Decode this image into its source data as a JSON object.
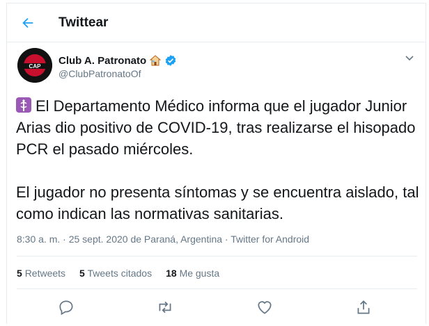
{
  "header": {
    "title": "Twittear"
  },
  "author": {
    "name": "Club A. Patronato",
    "handle": "@ClubPatronatoOf",
    "avatar_text": "CAP"
  },
  "tweet": {
    "paragraph1": "El Departamento Médico informa que el jugador Junior Arias dio positivo de COVID-19, tras realizarse el hisopado PCR el pasado miércoles.",
    "paragraph2": "El jugador no presenta síntomas y se encuentra aislado, tal como indican las normativas sanitarias."
  },
  "meta": {
    "time": "8:30 a. m.",
    "date": "25 sept. 2020",
    "place": "de Paraná, Argentina",
    "source": "Twitter for Android",
    "sep": " · "
  },
  "stats": {
    "retweets_count": "5",
    "retweets_label": "Retweets",
    "quotes_count": "5",
    "quotes_label": "Tweets citados",
    "likes_count": "18",
    "likes_label": "Me gusta"
  },
  "colors": {
    "accent": "#1da1f2",
    "verified": "#1da1f2",
    "muted": "#657786",
    "text": "#14171a",
    "border": "#e6ecf0"
  },
  "icons": [
    "back-arrow-icon",
    "house-icon",
    "verified-icon",
    "chevron-down-icon",
    "medical-emoji-icon",
    "reply-icon",
    "retweet-icon",
    "like-icon",
    "share-icon"
  ]
}
